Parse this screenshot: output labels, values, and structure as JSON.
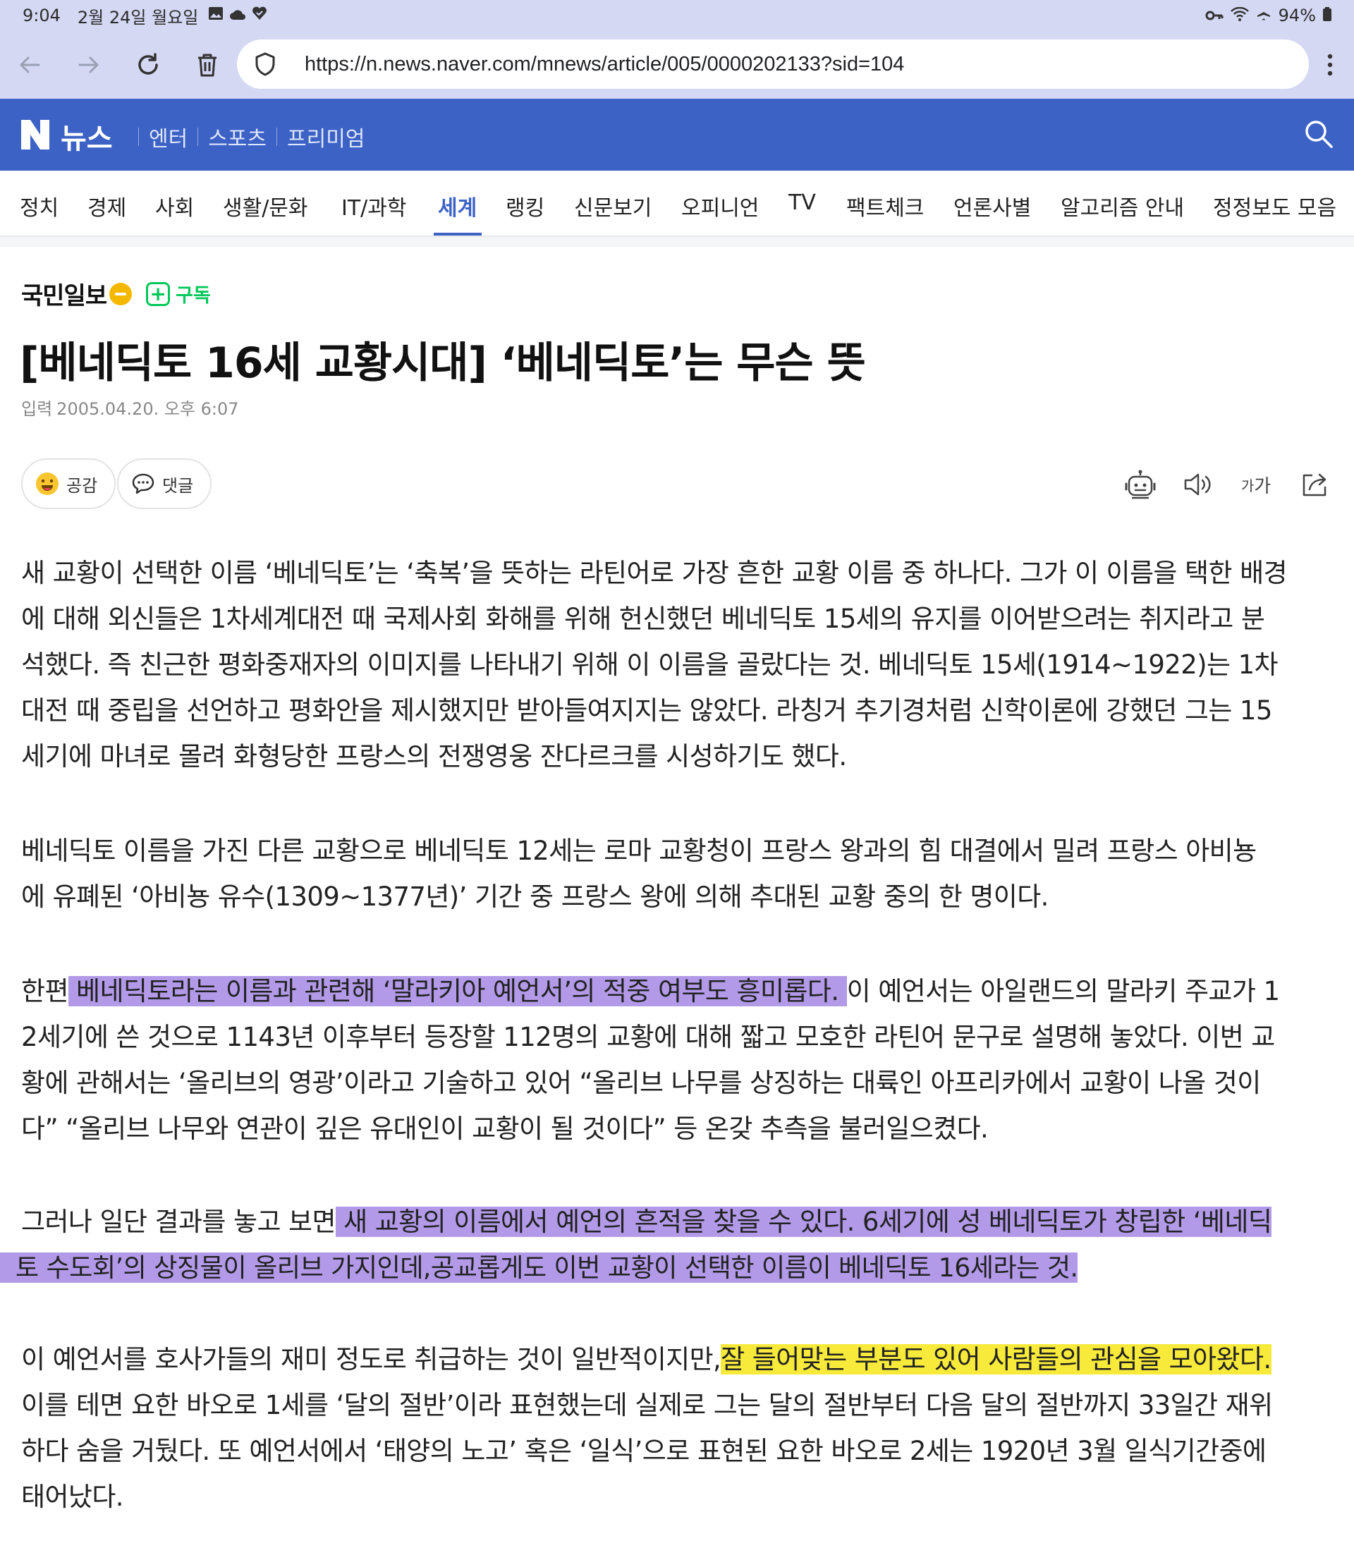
{
  "status_bar": {
    "time": "9:04",
    "date": "2월 24일 월요일",
    "battery": "94%",
    "icons": [
      "gallery-icon",
      "cloud-icon",
      "vpn-heart-icon",
      "key-icon",
      "wifi-icon",
      "airplane-icon",
      "battery-icon"
    ]
  },
  "browser": {
    "url": "https://n.news.naver.com/mnews/article/005/0000202133?sid=104",
    "buttons": [
      "back-icon",
      "forward-icon",
      "reload-icon",
      "trash-icon",
      "site-security-icon",
      "more-menu-icon"
    ]
  },
  "header": {
    "brand": "뉴스",
    "links": [
      "엔터",
      "스포츠",
      "프리미엄"
    ],
    "accent_color": "#3c62c6"
  },
  "sections": [
    "정치",
    "경제",
    "사회",
    "생활/문화",
    "IT/과학",
    "세계",
    "랭킹",
    "신문보기",
    "오피니언",
    "TV",
    "팩트체크",
    "언론사별",
    "알고리즘 안내",
    "정정보도 모음"
  ],
  "active_section": "세계",
  "article": {
    "press": "국민일보",
    "subscribe_label": "구독",
    "title": "[베네딕토 16세 교황시대] ‘베네딕토’는 무슨 뜻",
    "date_label": "입력",
    "date": "2005.04.20. 오후 6:07",
    "reaction_label": "공감",
    "comment_label": "댓글",
    "font_size_label_small": "가",
    "font_size_label_large": "가",
    "paragraphs": [
      {
        "lines": [
          [
            "새 교황이 선택한 이름 ‘베네딕토’는 ‘축복’을 뜻하는 라틴어로 가장 흔한 교황 이름 중 하나다. 그가 이 이름을 택한 배경"
          ],
          [
            "에 대해 외신들은 1차세계대전 때 국제사회 화해를 위해 헌신했던 베네딕토 15세의 유지를 이어받으려는 취지라고 분"
          ],
          [
            "석했다. 즉 친근한 평화중재자의 이미지를 나타내기 위해 이 이름을 골랐다는 것. 베네딕토 15세(1914~1922)는 1차"
          ],
          [
            "대전 때 중립을 선언하고 평화안을 제시했지만 받아들여지지는 않았다. 라칭거 추기경처럼 신학이론에 강했던 그는 15"
          ],
          [
            "세기에 마녀로 몰려 화형당한 프랑스의 전쟁영웅 잔다르크를 시성하기도 했다."
          ]
        ]
      },
      {
        "lines": [
          [
            "베네딕토 이름을 가진 다른 교황으로 베네딕토 12세는 로마 교황청이 프랑스 왕과의 힘 대결에서 밀려 프랑스 아비뇽"
          ],
          [
            "에 유폐된 ‘아비뇽 유수(1309~1377년)’ 기간 중 프랑스 왕에 의해 추대된 교황 중의 한 명이다."
          ]
        ]
      },
      {
        "lines": [
          [
            "한편",
            " 베네딕토라는 이름과 관련해 ‘말라키아 예언서’의 적중 여부도 흥미롭다. ",
            "이 예언서는 아일랜드의 말라키 주교가 1"
          ],
          [
            "2세기에 쓴 것으로 1143년 이후부터 등장할 112명의 교황에 대해 짧고 모호한 라틴어 문구로 설명해 놓았다. 이번 교"
          ],
          [
            "황에 관해서는 ‘올리브의 영광’이라고 기술하고 있어 “올리브 나무를 상징하는 대륙인 아프리카에서 교황이 나올 것이"
          ],
          [
            "다” “올리브 나무와 연관이 깊은 유대인이 교황이 될 것이다” 등 온갖 추측을 불러일으켰다."
          ]
        ]
      },
      {
        "lines": [
          [
            "그러나 일단 결과를 놓고 보면",
            " 새 교황의 이름에서 예언의 흔적을 찾을 수 있다. 6세기에 성 베네딕토가 창립한 ‘베네딕"
          ],
          [
            "",
            "토 수도회’의 상징물이 올리브 가지인데,공교롭게도 이번 교황이 선택한 이름이 베네딕토 16세라는 것. "
          ]
        ]
      },
      {
        "lines": [
          [
            "이 예언서를 호사가들의 재미 정도로 취급하는 것이 일반적이지만,",
            "잘 들어맞는 부분도 있어 사람들의 관심을 모아왔다."
          ],
          [
            "이를 테면 요한 바오로 1세를 ‘달의 절반’이라 표현했는데 실제로 그는 달의 절반부터 다음 달의 절반까지 33일간 재위"
          ],
          [
            "하다 숨을 거뒀다. 또 예언서에서 ‘태양의 노고’ 혹은 ‘일식’으로 표현된 요한 바오로 2세는 1920년 3월 일식기간중에"
          ],
          [
            "태어났다."
          ]
        ]
      }
    ],
    "highlight_colors": {
      "purple": "#b39ae8",
      "yellow": "#f7ea3a"
    }
  }
}
